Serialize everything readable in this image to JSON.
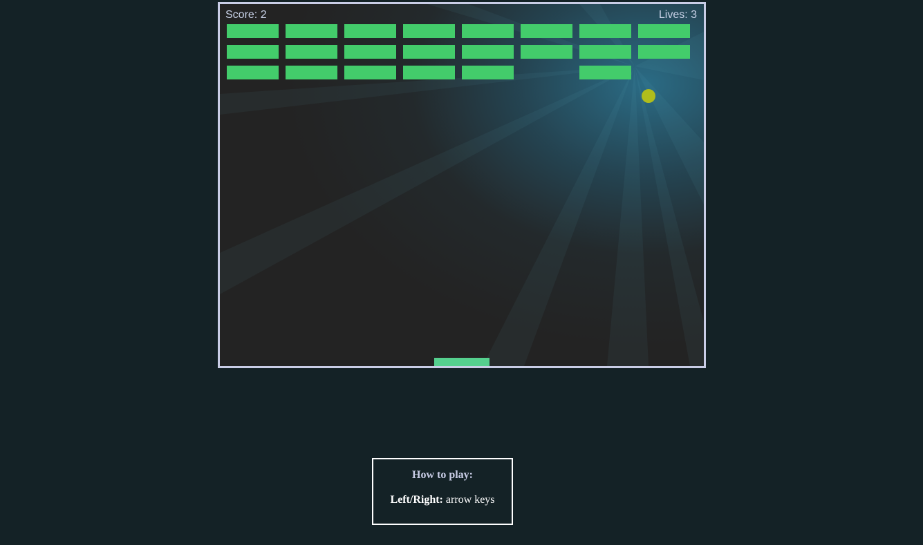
{
  "hud": {
    "score_text": "Score: 2",
    "lives_text": "Lives: 3",
    "score": 2,
    "lives": 3
  },
  "bricks": {
    "rows": 3,
    "columns": 8,
    "present": [
      [
        1,
        1,
        1,
        1,
        1,
        1,
        1,
        1
      ],
      [
        1,
        1,
        1,
        1,
        1,
        1,
        1,
        1
      ],
      [
        1,
        1,
        1,
        1,
        1,
        0,
        1,
        0
      ]
    ]
  },
  "help": {
    "title": "How to play:",
    "control_key": "Left/Right:",
    "control_desc": "arrow keys"
  },
  "colors": {
    "page_background": "#142226",
    "canvas_border": "#c9cde6",
    "brick": "#43cc6b",
    "ball": "#b0bd1c",
    "paddle": "#55d08e",
    "hud_text": "#c9d2e8"
  }
}
